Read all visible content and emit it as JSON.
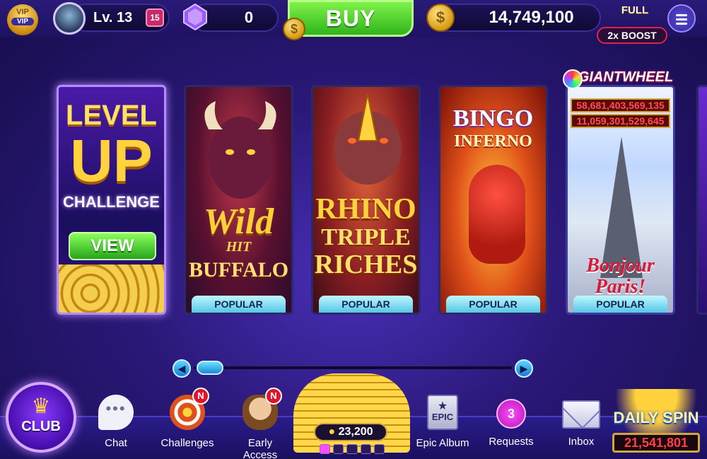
{
  "topbar": {
    "vip_label": "VIP",
    "vip_coin_text": "VIP",
    "level_label": "Lv. 13",
    "gift_count": "15",
    "gems": "0",
    "buy_label": "BUY",
    "coin_balance": "14,749,100",
    "full_label": "FULL",
    "boost_label": "2x BOOST",
    "menu_icon": "hamburger-menu-icon"
  },
  "games": [
    {
      "id": "level-up",
      "line1": "LEVEL",
      "line2": "UP",
      "line3": "CHALLENGE",
      "button": "VIEW"
    },
    {
      "id": "wild-hit-buffalo",
      "line1": "Wild",
      "line2": "HIT",
      "line3": "BUFFALO",
      "tag": "POPULAR"
    },
    {
      "id": "rhino-triple-riches",
      "line1": "RHINO",
      "line2": "TRIPLE",
      "line3": "RICHES",
      "tag": "POPULAR"
    },
    {
      "id": "bingo-inferno",
      "line1": "BINGO",
      "line2": "INFERNO",
      "tag": "POPULAR"
    },
    {
      "id": "giant-wheel-paris",
      "title": "GIANTWHEEL",
      "jackpot1": "58,681,403,569,135",
      "jackpot2": "11,059,301,529,645",
      "line1": "Bonjour Paris!",
      "tag": "POPULAR"
    }
  ],
  "bottom": {
    "club_label": "CLUB",
    "chat_label": "Chat",
    "challenges_label": "Challenges",
    "challenges_badge": "N",
    "early_access_label": "Early Access",
    "early_access_badge": "N",
    "prize_amount": "23,200",
    "epic_album_label": "Epic Album",
    "epic_icon_text": "EPIC",
    "requests_label": "Requests",
    "requests_count": "3",
    "inbox_label": "Inbox",
    "daily_spin_label": "DAILY SPIN",
    "daily_spin_value": "21,541,801"
  },
  "colors": {
    "accent_green": "#2fb41c",
    "background": "#2a1877",
    "popular_tag": "#57c6e6"
  }
}
